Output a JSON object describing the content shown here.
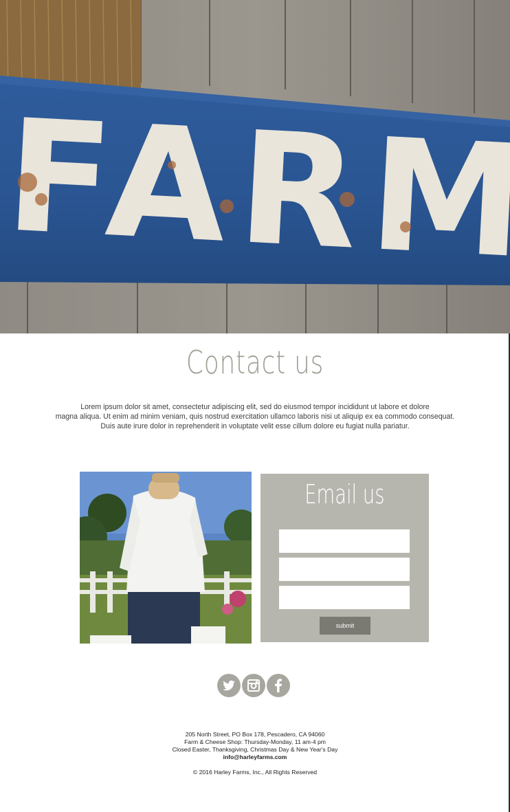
{
  "hero": {
    "sign_text": "FARM"
  },
  "contact": {
    "title": "Contact us",
    "intro_line1": "Lorem ipsum dolor sit amet, consectetur adipiscing elit, sed do eiusmod tempor incididunt ut labore et dolore",
    "intro_line2": "magna aliqua. Ut enim ad minim veniam, quis nostrud exercitation ullamco laboris nisi ut aliquip ex ea commodo consequat.",
    "intro_line3": "Duis aute irure dolor in reprehenderit in voluptate velit esse cillum dolore eu fugiat nulla pariatur."
  },
  "email_form": {
    "title": "Email us",
    "field1_value": "",
    "field2_value": "",
    "field3_value": "",
    "submit_label": "submit"
  },
  "social": {
    "icons": [
      "twitter-icon",
      "instagram-icon",
      "facebook-icon"
    ],
    "color": "#a8a79f"
  },
  "footer": {
    "address": "205 North Street, PO Box 178, Pescadero, CA 94060",
    "shop_hours": "Farm & Cheese Shop: Thursday-Monday, 11 am-4 pm",
    "closed": "Closed Easter, Thanksgiving, Christmas Day & New Year's Day",
    "email": "info@harleyfarms.com",
    "copyright": "© 2016 Harley Farms, Inc., All Rights Reserved"
  },
  "colors": {
    "accent_gray": "#b7b6ae",
    "title_gray": "#9e9d93",
    "button_gray": "#7a7a72",
    "sign_blue": "#2e5b9a"
  }
}
